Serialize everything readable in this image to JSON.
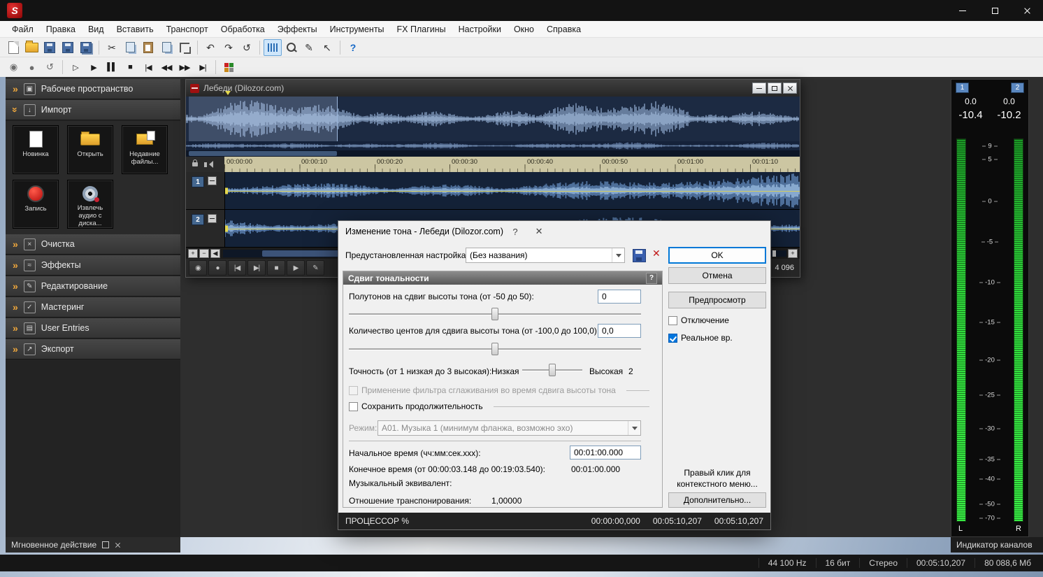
{
  "colors": {
    "accent": "#0078d7",
    "meter_green": "#2ed83a",
    "record_red": "#c01818",
    "marker_yellow": "#e4d84e",
    "titlebar": "#131313"
  },
  "titlebar": {
    "logo_letter": "S"
  },
  "menu": {
    "items": [
      "Файл",
      "Правка",
      "Вид",
      "Вставить",
      "Транспорт",
      "Обработка",
      "Эффекты",
      "Инструменты",
      "FX Плагины",
      "Настройки",
      "Окно",
      "Справка"
    ]
  },
  "toolbar_icons": {
    "cut": "✂",
    "undo": "↶",
    "redo": "↷",
    "repeat": "↺",
    "pencil": "✎",
    "arrow": "↖",
    "help": "?"
  },
  "transport": {
    "items": [
      {
        "name": "record",
        "glyph": "◉"
      },
      {
        "name": "loop-playback",
        "glyph": "●"
      },
      {
        "name": "restart",
        "glyph": "↺"
      },
      {
        "name": "play-all",
        "glyph": "▷"
      },
      {
        "name": "play",
        "glyph": "▶"
      },
      {
        "name": "pause",
        "glyph": "▌▌"
      },
      {
        "name": "stop",
        "glyph": "■"
      },
      {
        "name": "go-to-start",
        "glyph": "|◀"
      },
      {
        "name": "rewind",
        "glyph": "◀◀"
      },
      {
        "name": "fast-forward",
        "glyph": "▶▶"
      },
      {
        "name": "go-to-end",
        "glyph": "▶|"
      }
    ]
  },
  "sidebar": {
    "sections": [
      {
        "label": "Рабочее пространство",
        "icon": "▣"
      },
      {
        "label": "Импорт",
        "icon": "↓"
      },
      {
        "label": "Очистка",
        "icon": "×"
      },
      {
        "label": "Эффекты",
        "icon": "≈"
      },
      {
        "label": "Редактирование",
        "icon": "✎"
      },
      {
        "label": "Мастеринг",
        "icon": "✓"
      },
      {
        "label": "User Entries",
        "icon": "▤"
      },
      {
        "label": "Экспорт",
        "icon": "↗"
      }
    ],
    "import_buttons": [
      {
        "label": "Новинка"
      },
      {
        "label": "Открыть"
      },
      {
        "label": "Недавние файлы..."
      },
      {
        "label": "Запись"
      },
      {
        "label": "Извлечь аудио с диска..."
      }
    ],
    "instant_action": "Мгновенное действие"
  },
  "doc": {
    "title": "Лебеди (Dilozor.com)",
    "ruler_times": [
      "00:00:00",
      "00:00:10",
      "00:00:20",
      "00:00:30",
      "00:00:40",
      "00:00:50",
      "00:01:00",
      "00:01:10"
    ],
    "tracks": [
      "1",
      "2"
    ],
    "zoom_ratio": "4 096"
  },
  "doc_transport": {
    "items": [
      {
        "name": "record",
        "glyph": "◉"
      },
      {
        "name": "loop-playback",
        "glyph": "●"
      },
      {
        "name": "go-to-start",
        "glyph": "|◀"
      },
      {
        "name": "go-to-end",
        "glyph": "▶|"
      },
      {
        "name": "stop",
        "glyph": "■"
      },
      {
        "name": "play",
        "glyph": "▶"
      },
      {
        "name": "pencil-tool",
        "glyph": "✎"
      }
    ]
  },
  "dialog": {
    "title": "Изменение тона - Лебеди (Dilozor.com)",
    "preset_label": "Предустановленная настройка:",
    "preset_value": "(Без названия)",
    "ok": "OK",
    "cancel": "Отмена",
    "preview": "Предпросмотр",
    "bypass": "Отключение",
    "realtime": "Реальное вр.",
    "group_title": "Сдвиг тональности",
    "semitones_label": "Полутонов на сдвиг высоты тона (от -50 до 50):",
    "semitones_value": "0",
    "cents_label": "Количество центов для сдвига высоты тона (от -100,0 до 100,0):",
    "cents_value": "0,0",
    "accuracy_label": "Точность (от 1 низкая до 3 высокая):",
    "accuracy_low": "Низкая",
    "accuracy_high": "Высокая",
    "accuracy_value": "2",
    "antialias_label": "Применение фильтра сглаживания во время сдвига высоты тона",
    "preserve_label": "Сохранить продолжительность",
    "mode_label": "Режим:",
    "mode_value": "A01. Музыка 1 (минимум фланжа, возможно эхо)",
    "start_label": "Начальное время (чч:мм:сек.xxx):",
    "start_value": "00:01:00.000",
    "end_label": "Конечное время (от 00:00:03.148 до 00:19:03.540):",
    "end_value": "00:01:00.000",
    "musical_label": "Музыкальный эквивалент:",
    "ratio_label": "Отношение транспонирования:",
    "ratio_value": "1,00000",
    "context_hint": "Правый клик для контекстного меню...",
    "more_button": "Дополнительно...",
    "cpu_label": "ПРОЦЕССОР %",
    "times": [
      "00:00:00,000",
      "00:05:10,207",
      "00:05:10,207"
    ]
  },
  "meters": {
    "channels": [
      "1",
      "2"
    ],
    "peaks": [
      "0.0",
      "0.0"
    ],
    "holds": [
      "-10.4",
      "-10.2"
    ],
    "scale": [
      "9",
      "5",
      "0",
      "-5",
      "-10",
      "-15",
      "-20",
      "-25",
      "-30",
      "-35",
      "-40",
      "-50",
      "-70"
    ],
    "lr": [
      "L",
      "R"
    ],
    "caption": "Индикатор каналов"
  },
  "statusbar": {
    "segments": [
      "44 100 Hz",
      "16 бит",
      "Стерео",
      "00:05:10,207",
      "80 088,6 Мб"
    ]
  },
  "icons": {
    "chevron": "»",
    "dialog_help": "?",
    "dialog_close": "✕",
    "group_help": "?",
    "delete_preset": "✕",
    "plus": "+",
    "minus": "−",
    "arrow_left": "◀",
    "arrow_right": "▶"
  }
}
